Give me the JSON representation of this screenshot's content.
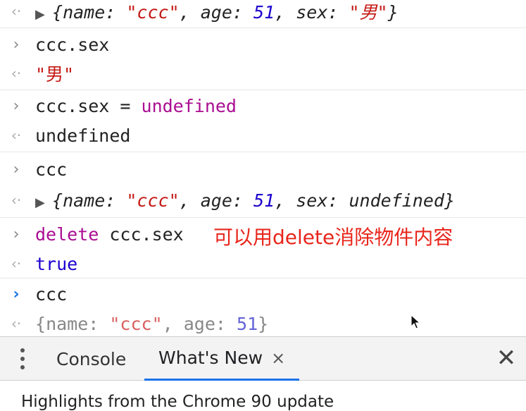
{
  "console": {
    "row1": {
      "brace_open": "{",
      "k1": "name: ",
      "v1": "\"ccc\"",
      "sep1": ", ",
      "k2": "age: ",
      "v2": "51",
      "sep2": ", ",
      "k3": "sex: ",
      "v3": "\"男\"",
      "brace_close": "}"
    },
    "row2": {
      "input": "ccc.sex",
      "output": "\"男\""
    },
    "row3": {
      "input_a": "ccc.sex = ",
      "input_b": "undefined",
      "output": "undefined"
    },
    "row4": {
      "input": "ccc",
      "brace_open": "{",
      "k1": "name: ",
      "v1": "\"ccc\"",
      "sep1": ", ",
      "k2": "age: ",
      "v2": "51",
      "sep2": ", ",
      "k3": "sex: ",
      "v3": "undefined",
      "brace_close": "}"
    },
    "row5": {
      "input_kw": "delete",
      "input_rest": " ccc.sex",
      "output": "true"
    },
    "row6": {
      "input": "ccc",
      "brace_open": "{",
      "k1": "name: ",
      "v1": "\"ccc\"",
      "sep1": ", ",
      "k2": "age: ",
      "v2": "51",
      "brace_close": "}"
    }
  },
  "annotation": {
    "text": "可以用delete消除物件内容",
    "color": "#e8261c"
  },
  "drawer": {
    "tabs": [
      {
        "label": "Console",
        "active": false
      },
      {
        "label": "What's New",
        "active": true
      }
    ],
    "tab_close_glyph": "×",
    "close_glyph": "✕",
    "highlights": "Highlights from the Chrome 90 update"
  },
  "icons": {
    "input_prompt": "›",
    "output_arrow": "‹·",
    "expand": "▶",
    "kebab": "more-vert-icon"
  },
  "colors": {
    "accent": "#1a73e8",
    "string": "#c41a16",
    "number": "#1c00cf",
    "keyword": "#aa0d91"
  }
}
